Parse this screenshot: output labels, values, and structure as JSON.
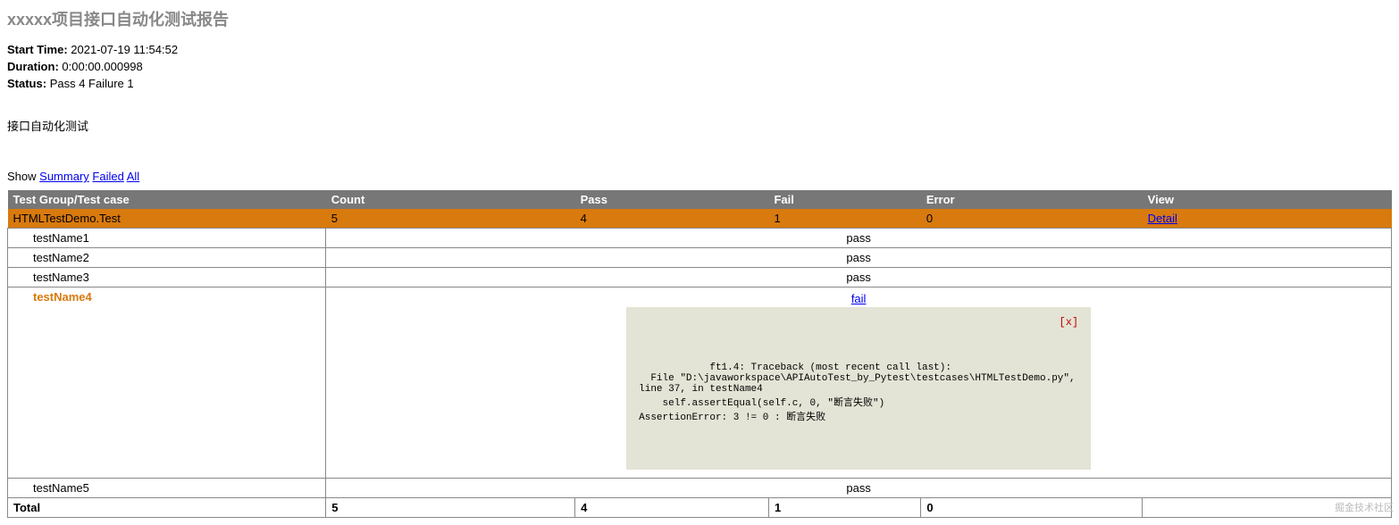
{
  "title": "xxxxx项目接口自动化测试报告",
  "meta": {
    "start_label": "Start Time:",
    "start_value": "2021-07-19 11:54:52",
    "duration_label": "Duration:",
    "duration_value": "0:00:00.000998",
    "status_label": "Status:",
    "status_value": "Pass 4 Failure 1"
  },
  "description": "接口自动化测试",
  "filter": {
    "show": "Show",
    "summary": "Summary",
    "failed": "Failed",
    "all": "All"
  },
  "headers": {
    "test": "Test Group/Test case",
    "count": "Count",
    "pass": "Pass",
    "fail": "Fail",
    "error": "Error",
    "view": "View"
  },
  "group": {
    "name": "HTMLTestDemo.Test",
    "count": "5",
    "pass": "4",
    "fail": "1",
    "error": "0",
    "detail": "Detail"
  },
  "cases": {
    "c1": {
      "name": "testName1",
      "result": "pass"
    },
    "c2": {
      "name": "testName2",
      "result": "pass"
    },
    "c3": {
      "name": "testName3",
      "result": "pass"
    },
    "c5": {
      "name": "testName5",
      "result": "pass"
    }
  },
  "failcase": {
    "name": "testName4",
    "link": "fail",
    "close": "[x]",
    "traceback": "ft1.4: Traceback (most recent call last):\n  File \"D:\\javaworkspace\\APIAutoTest_by_Pytest\\testcases\\HTMLTestDemo.py\", line 37, in testName4\n    self.assertEqual(self.c, 0, \"断言失败\")\nAssertionError: 3 != 0 : 断言失败"
  },
  "total": {
    "label": "Total",
    "count": "5",
    "pass": "4",
    "fail": "1",
    "error": "0"
  },
  "watermark": "掘金技术社区"
}
